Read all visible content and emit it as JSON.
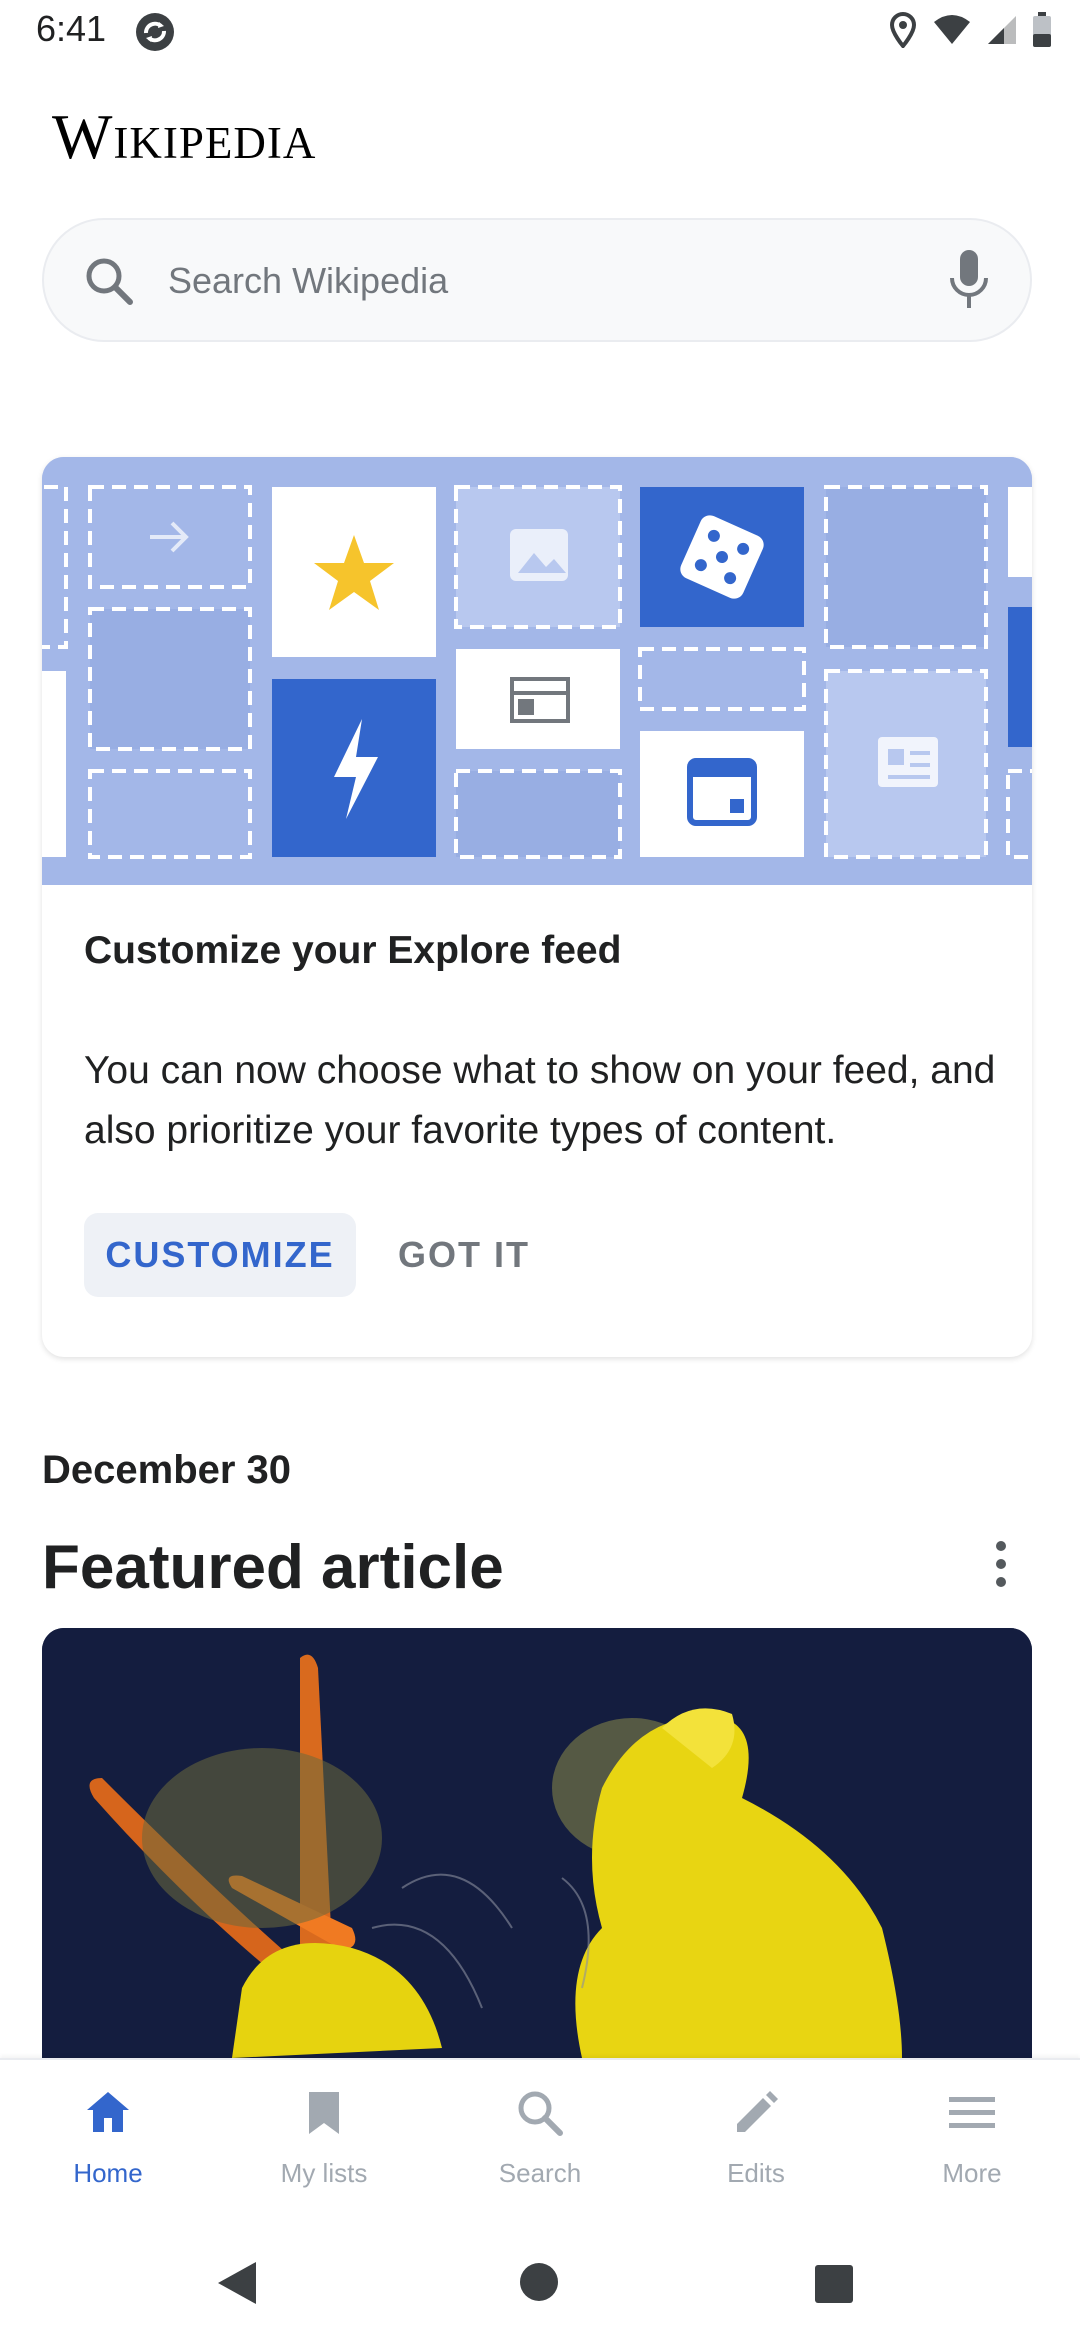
{
  "status_bar": {
    "time": "6:41"
  },
  "header": {
    "wordmark": "Wikipedia"
  },
  "search": {
    "placeholder": "Search Wikipedia"
  },
  "card": {
    "title": "Customize your Explore feed",
    "body": "You can now choose what to show on your feed, and also prioritize your favorite types of content.",
    "primary_button": "CUSTOMIZE",
    "secondary_button": "GOT IT"
  },
  "feed": {
    "date": "December 30",
    "section_title": "Featured article"
  },
  "bottom_nav": {
    "items": [
      {
        "label": "Home",
        "icon": "home-icon",
        "active": true
      },
      {
        "label": "My lists",
        "icon": "bookmark-icon",
        "active": false
      },
      {
        "label": "Search",
        "icon": "search-icon",
        "active": false
      },
      {
        "label": "Edits",
        "icon": "pencil-icon",
        "active": false
      },
      {
        "label": "More",
        "icon": "menu-icon",
        "active": false
      }
    ]
  },
  "colors": {
    "accent": "#3366cc",
    "illustration_bg": "#a3b7e8",
    "inactive": "#a2a9b1"
  }
}
